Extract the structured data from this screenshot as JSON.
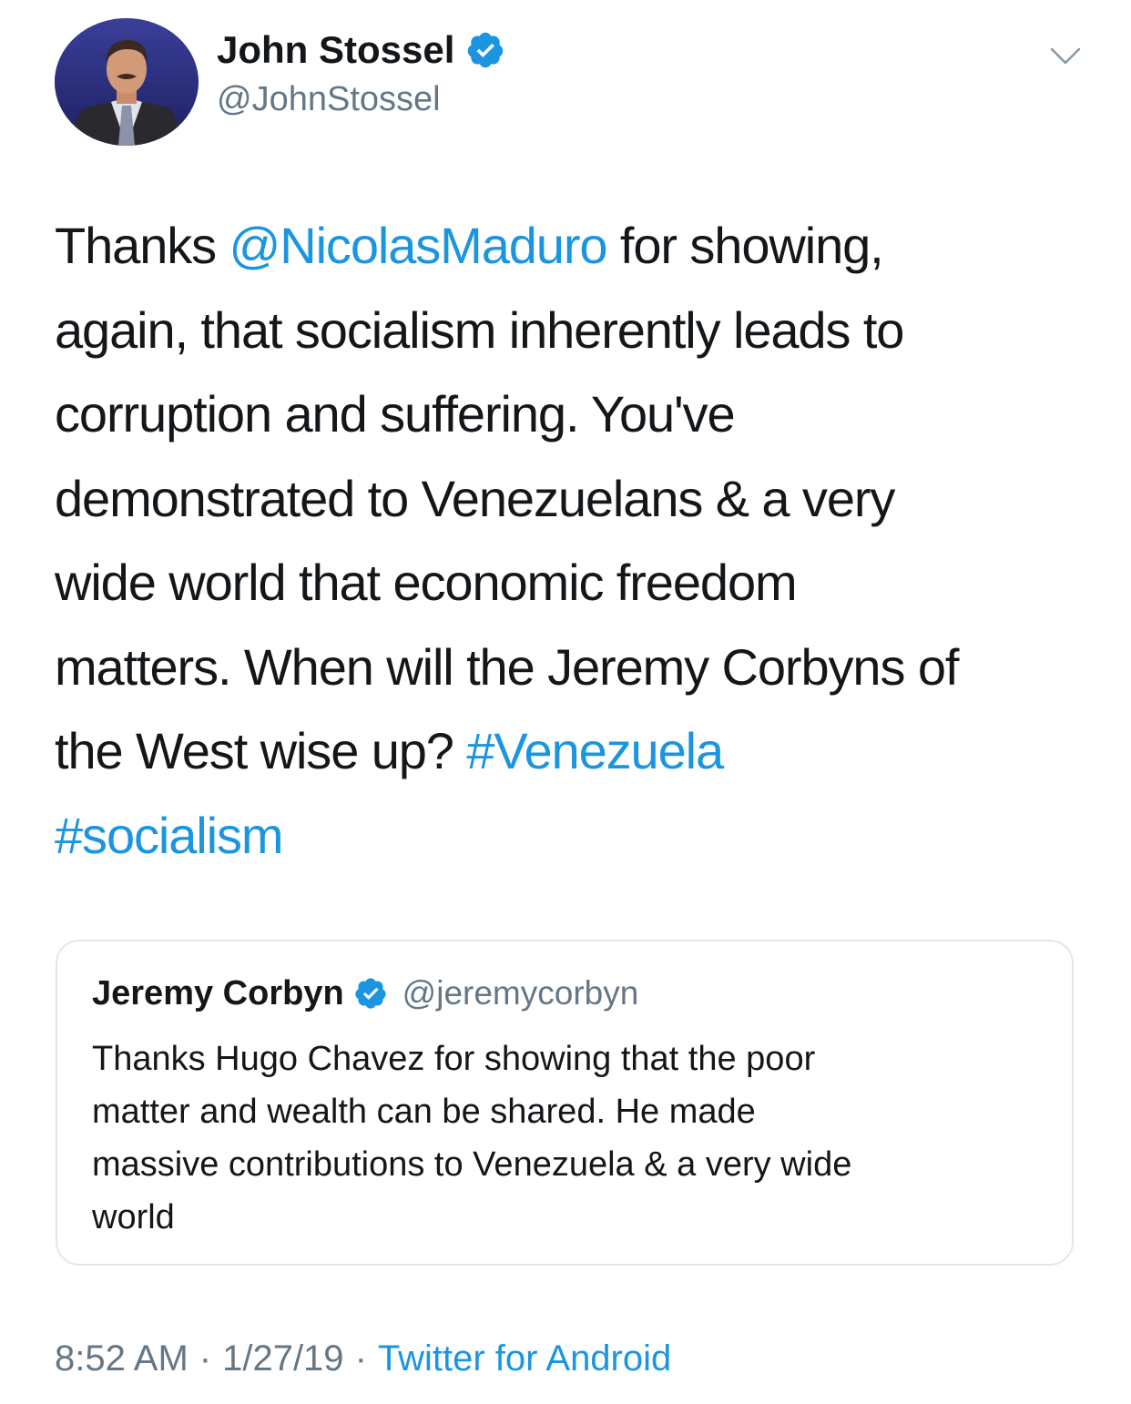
{
  "author": {
    "display_name": "John Stossel",
    "handle": "@JohnStossel",
    "avatar_icon": "profile-photo",
    "verified_icon": "verified-badge-icon"
  },
  "menu_icon": "chevron-down-icon",
  "tweet": {
    "lines": [
      [
        {
          "text": "Thanks ",
          "type": "text"
        },
        {
          "text": "@NicolasMaduro",
          "type": "mention"
        },
        {
          "text": " for showing,",
          "type": "text"
        }
      ],
      [
        {
          "text": "again, that socialism inherently leads to",
          "type": "text"
        }
      ],
      [
        {
          "text": "corruption and suffering. You've",
          "type": "text"
        }
      ],
      [
        {
          "text": "demonstrated to Venezuelans & a very",
          "type": "text"
        }
      ],
      [
        {
          "text": "wide world that economic freedom",
          "type": "text"
        }
      ],
      [
        {
          "text": "matters. When will the Jeremy Corbyns of",
          "type": "text"
        }
      ],
      [
        {
          "text": "the West wise up? ",
          "type": "text"
        },
        {
          "text": "#Venezuela",
          "type": "hashtag"
        }
      ],
      [
        {
          "text": "#socialism",
          "type": "hashtag"
        }
      ]
    ]
  },
  "quoted_tweet": {
    "display_name": "Jeremy Corbyn",
    "handle": "@jeremycorbyn",
    "lines": [
      "Thanks Hugo Chavez for showing that the poor",
      "matter and wealth can be shared. He made",
      "massive contributions to Venezuela & a very wide",
      "world"
    ]
  },
  "meta": {
    "time": "8:52 AM",
    "separator": "·",
    "date": "1/27/19",
    "source": "Twitter for Android"
  },
  "colors": {
    "link": "#1b95e0",
    "text": "#14171a",
    "secondary": "#657786",
    "border": "#e1e8ed"
  }
}
